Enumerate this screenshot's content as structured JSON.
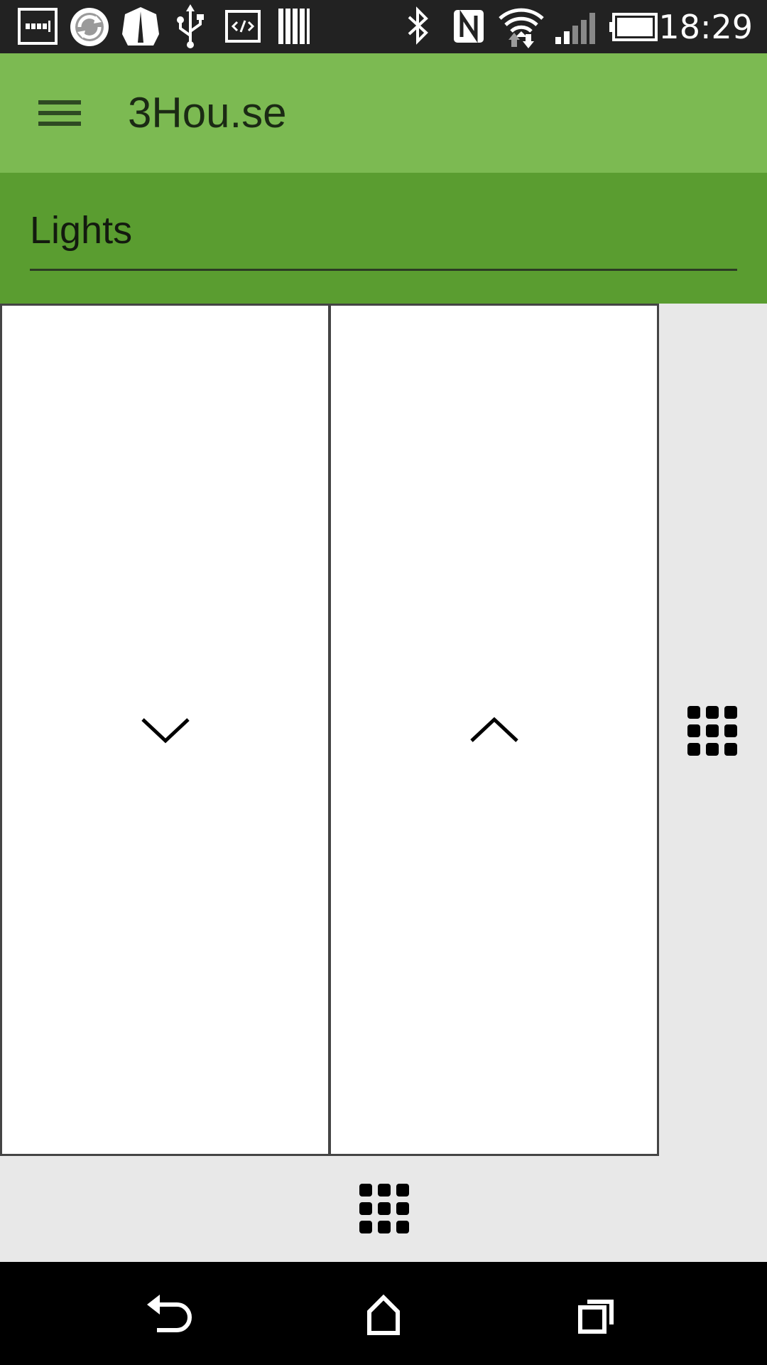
{
  "status_bar": {
    "time": "18:29",
    "icons": [
      "keyboard-icon",
      "sync-icon",
      "shield-icon",
      "usb-icon",
      "developer-icon",
      "barcode-icon",
      "bluetooth-icon",
      "nfc-icon",
      "wifi-icon",
      "signal-icon",
      "battery-icon"
    ]
  },
  "app_bar": {
    "title": "3Hou.se",
    "menu_icon": "hamburger-menu-icon"
  },
  "section": {
    "title": "Lights"
  },
  "controls": {
    "down_icon": "chevron-down-icon",
    "up_icon": "chevron-up-icon",
    "right_grid_icon": "grid-icon",
    "bottom_grid_icon": "grid-icon"
  },
  "nav_bar": {
    "icons": [
      "back-icon",
      "home-icon",
      "recents-icon"
    ]
  },
  "colors": {
    "status_bar": "#222222",
    "app_bar": "#7cba52",
    "section_header": "#5a9d30",
    "content_bg": "#e8e8e8",
    "panel_bg": "#ffffff",
    "nav_bar": "#000000"
  }
}
